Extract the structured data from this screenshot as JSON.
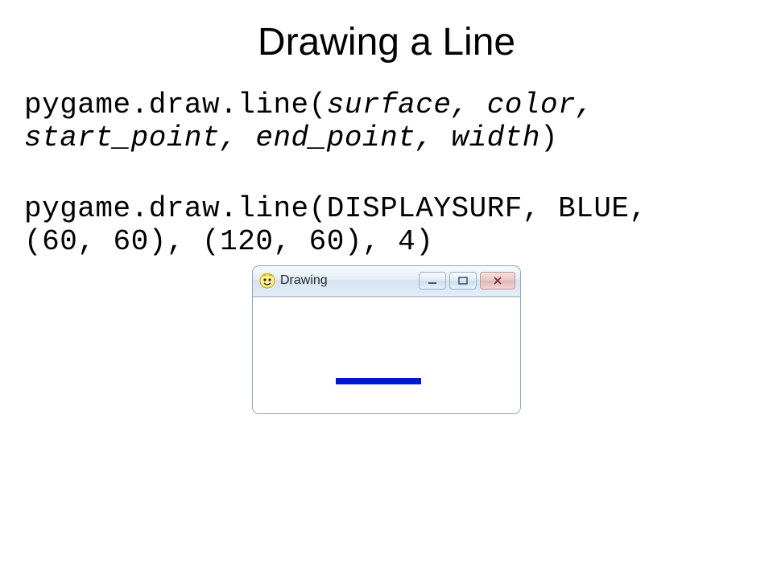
{
  "title": "Drawing a Line",
  "snippet1": {
    "prefix": "pygame.draw.line(",
    "args": "surface, color, start_point, end_point, width",
    "suffix": ")"
  },
  "snippet2_line1": "pygame.draw.line(DISPLAYSURF, BLUE,",
  "snippet2_line2": "(60, 60), (120, 60), 4)",
  "window": {
    "title": "Drawing"
  }
}
